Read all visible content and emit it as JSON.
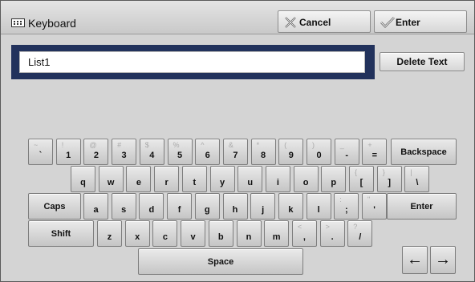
{
  "window": {
    "title": "Keyboard",
    "cancel_label": "Cancel",
    "enter_label": "Enter"
  },
  "input": {
    "value": "List1",
    "delete_label": "Delete Text"
  },
  "keys": {
    "row1": [
      {
        "id": "backtick",
        "main": "`",
        "sub": "~"
      },
      {
        "id": "1",
        "main": "1",
        "sub": "!"
      },
      {
        "id": "2",
        "main": "2",
        "sub": "@"
      },
      {
        "id": "3",
        "main": "3",
        "sub": "#"
      },
      {
        "id": "4",
        "main": "4",
        "sub": "$"
      },
      {
        "id": "5",
        "main": "5",
        "sub": "%"
      },
      {
        "id": "6",
        "main": "6",
        "sub": "^"
      },
      {
        "id": "7",
        "main": "7",
        "sub": "&"
      },
      {
        "id": "8",
        "main": "8",
        "sub": "*"
      },
      {
        "id": "9",
        "main": "9",
        "sub": "("
      },
      {
        "id": "0",
        "main": "0",
        "sub": ")"
      },
      {
        "id": "minus",
        "main": "-",
        "sub": "_"
      },
      {
        "id": "equals",
        "main": "=",
        "sub": "+"
      }
    ],
    "backspace": "Backspace",
    "row2": [
      {
        "id": "q",
        "main": "q"
      },
      {
        "id": "w",
        "main": "w"
      },
      {
        "id": "e",
        "main": "e"
      },
      {
        "id": "r",
        "main": "r"
      },
      {
        "id": "t",
        "main": "t"
      },
      {
        "id": "y",
        "main": "y"
      },
      {
        "id": "u",
        "main": "u"
      },
      {
        "id": "i",
        "main": "i"
      },
      {
        "id": "o",
        "main": "o"
      },
      {
        "id": "p",
        "main": "p"
      },
      {
        "id": "lbracket",
        "main": "[",
        "sub": "{"
      },
      {
        "id": "rbracket",
        "main": "]",
        "sub": "}"
      },
      {
        "id": "backslash",
        "main": "\\",
        "sub": "|"
      }
    ],
    "caps": "Caps",
    "row3": [
      {
        "id": "a",
        "main": "a"
      },
      {
        "id": "s",
        "main": "s"
      },
      {
        "id": "d",
        "main": "d"
      },
      {
        "id": "f",
        "main": "f"
      },
      {
        "id": "g",
        "main": "g"
      },
      {
        "id": "h",
        "main": "h"
      },
      {
        "id": "j",
        "main": "j"
      },
      {
        "id": "k",
        "main": "k"
      },
      {
        "id": "l",
        "main": "l"
      },
      {
        "id": "semicolon",
        "main": ";",
        "sub": ":"
      },
      {
        "id": "quote",
        "main": "'",
        "sub": "\""
      }
    ],
    "enter": "Enter",
    "shift": "Shift",
    "row4": [
      {
        "id": "z",
        "main": "z"
      },
      {
        "id": "x",
        "main": "x"
      },
      {
        "id": "c",
        "main": "c"
      },
      {
        "id": "v",
        "main": "v"
      },
      {
        "id": "b",
        "main": "b"
      },
      {
        "id": "n",
        "main": "n"
      },
      {
        "id": "m",
        "main": "m"
      },
      {
        "id": "comma",
        "main": ",",
        "sub": "<"
      },
      {
        "id": "period",
        "main": ".",
        "sub": ">"
      },
      {
        "id": "slash",
        "main": "/",
        "sub": "?"
      }
    ],
    "space": "Space",
    "left_arrow": "←",
    "right_arrow": "→"
  },
  "icons": {
    "title": "keyboard-icon",
    "cancel": "close-x-icon",
    "enter": "checkmark-icon"
  }
}
